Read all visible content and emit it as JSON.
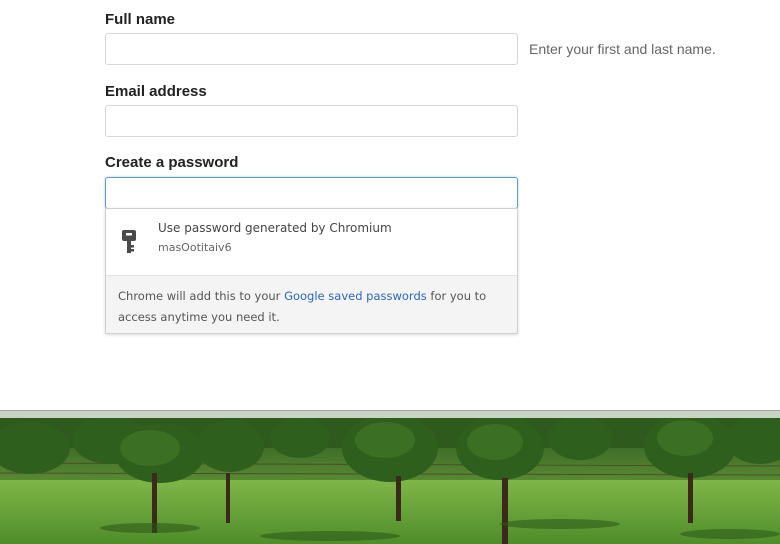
{
  "form": {
    "full_name": {
      "label": "Full name",
      "value": "",
      "hint": "Enter your first and last name."
    },
    "email": {
      "label": "Email address",
      "value": ""
    },
    "password": {
      "label": "Create a password",
      "value": ""
    }
  },
  "password_suggestion": {
    "icon": "key-icon",
    "title": "Use password generated by Chromium",
    "generated_password": "masOotitaiv6",
    "footer_before": "Chrome will add this to your ",
    "footer_link": "Google saved passwords",
    "footer_after": " for you to access anytime you need it."
  },
  "colors": {
    "focus_border": "#5b9dd9",
    "link": "#2a66c4"
  }
}
